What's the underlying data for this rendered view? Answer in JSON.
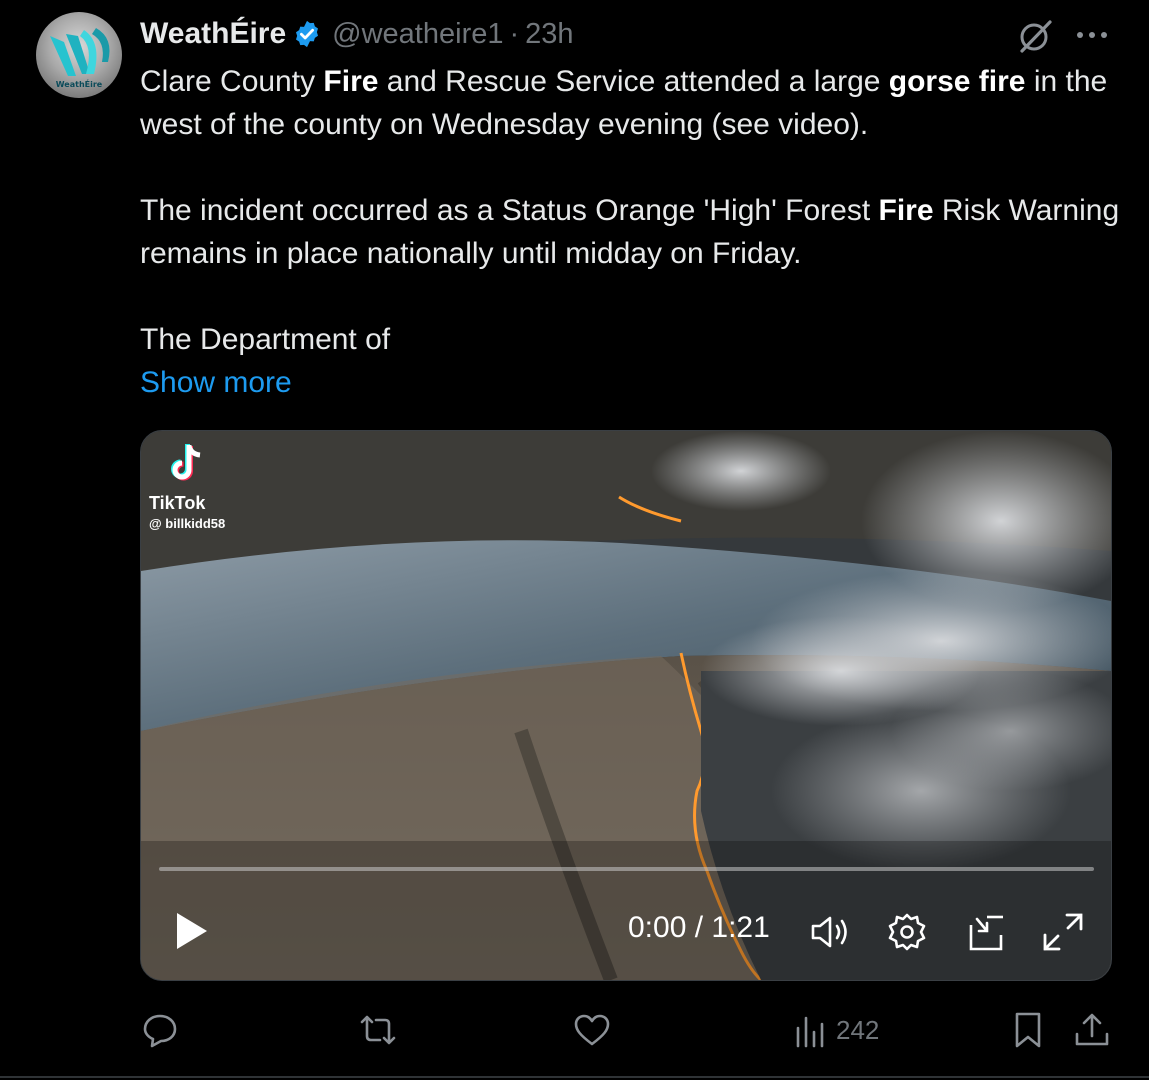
{
  "post": {
    "author": {
      "display_name": "WeathÉire",
      "verified": true,
      "handle": "@weatheire1",
      "separator": "·",
      "time": "23h",
      "avatar_text": "WeathÉire"
    },
    "text": {
      "para1_a": "Clare County ",
      "para1_b": "Fire",
      "para1_c": " and Rescue Service attended a large ",
      "para1_d": "gorse fire",
      "para1_e": " in the west of the county on Wednesday evening (see video).",
      "para2_a": "The incident occurred as a Status Orange 'High' Forest ",
      "para2_b": "Fire",
      "para2_c": " Risk Warning remains in place nationally until midday on Friday.",
      "para3": "The Department of",
      "show_more": "Show more"
    },
    "video": {
      "watermark_brand": "TikTok",
      "watermark_user": "@ billkidd58",
      "timecode": "0:00 / 1:21",
      "progress": 0
    },
    "actions": {
      "views": "242"
    },
    "icons": [
      "verified-icon",
      "grok-icon",
      "more-icon",
      "tiktok-logo-icon",
      "play-icon",
      "volume-icon",
      "settings-icon",
      "pip-icon",
      "fullscreen-icon",
      "reply-icon",
      "retweet-icon",
      "like-icon",
      "views-icon",
      "bookmark-icon",
      "share-icon"
    ],
    "colors": {
      "accent": "#1d9bf0",
      "text": "#e7e9ea",
      "muted": "#71767b",
      "background": "#000000"
    }
  }
}
